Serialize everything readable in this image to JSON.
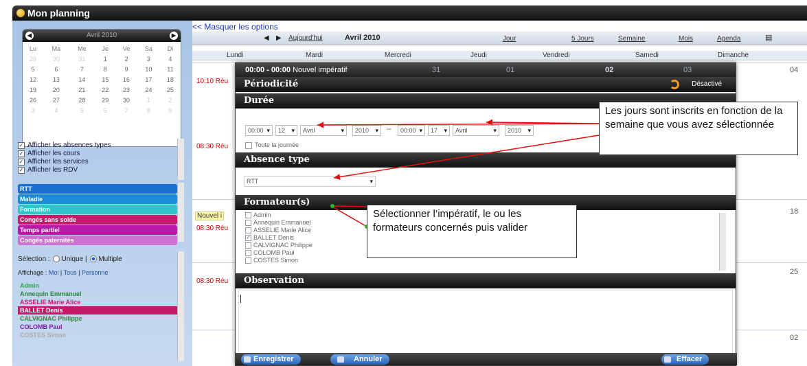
{
  "window": {
    "title": "Mon planning"
  },
  "minical": {
    "month_label": "Avril 2010",
    "weekdays": [
      "Lu",
      "Ma",
      "Me",
      "Je",
      "Ve",
      "Sa",
      "Di"
    ],
    "weeks": [
      [
        "29",
        "30",
        "31",
        "1",
        "2",
        "3",
        "4"
      ],
      [
        "5",
        "6",
        "7",
        "8",
        "9",
        "10",
        "11"
      ],
      [
        "12",
        "13",
        "14",
        "15",
        "16",
        "17",
        "18"
      ],
      [
        "19",
        "20",
        "21",
        "22",
        "23",
        "24",
        "25"
      ],
      [
        "26",
        "27",
        "28",
        "29",
        "30",
        "1",
        "2"
      ],
      [
        "3",
        "4",
        "5",
        "6",
        "7",
        "8",
        "9"
      ]
    ]
  },
  "filters": {
    "items": [
      "Afficher les absences types",
      "Afficher les cours",
      "Afficher les services",
      "Afficher les RDV"
    ]
  },
  "absences": [
    {
      "label": "RTT",
      "color": "#1a6fd0"
    },
    {
      "label": "Maladie",
      "color": "#1c8cd8"
    },
    {
      "label": "Formation",
      "color": "#2ec4c8"
    },
    {
      "label": "Congés sans solde",
      "color": "#c41a6a"
    },
    {
      "label": "Temps partiel",
      "color": "#b81aa8"
    },
    {
      "label": "Congés paternités",
      "color": "#d070d0"
    }
  ],
  "selection": {
    "label": "Sélection :",
    "unique": "Unique",
    "multiple": "Multiple"
  },
  "affichage": {
    "label": "Affichage :",
    "moi": "Moi",
    "tous": "Tous",
    "personne": "Personne"
  },
  "people": [
    {
      "name": "Admin",
      "color": "#2aa84a"
    },
    {
      "name": "Annequin Emmanuel",
      "color": "#2a8a3a"
    },
    {
      "name": "ASSELIE Marie Alice",
      "color": "#c41a6a"
    },
    {
      "name": "BALLET Denis",
      "color": "#ffffff"
    },
    {
      "name": "CALVIGNAC Philippe",
      "color": "#2a8a3a"
    },
    {
      "name": "COLOMB Paul",
      "color": "#7a1aa8"
    },
    {
      "name": "COSTES Simon",
      "color": "#aaaaaa"
    }
  ],
  "main": {
    "hide_options": "<< Masquer les options",
    "today": "Aujourd'hui",
    "month": "Avril 2010",
    "views": [
      "Jour",
      "5 Jours",
      "Semaine",
      "Mois",
      "Agenda"
    ],
    "days": [
      "Lundi",
      "Mardi",
      "Mercredi",
      "Jeudi",
      "Vendredi",
      "Samedi",
      "Dimanche"
    ],
    "events": [
      "10:10 Réu",
      "08:30 Réu",
      "Nouvel i",
      "08:30 Réu",
      "08:30 Réu"
    ],
    "dates": [
      "04",
      "18",
      "25",
      "02"
    ]
  },
  "modal": {
    "title_time": "00:00 - 00:00",
    "title_text": "Nouvel impératif",
    "header_dates": [
      "31",
      "01",
      "02",
      "03"
    ],
    "periodicite": "Périodicité",
    "desactive": "Désactivé",
    "duree": "Durée",
    "start": {
      "hour": "00:00",
      "day": "12",
      "month": "Avril",
      "year": "2010"
    },
    "end": {
      "hour": "00:00",
      "day": "17",
      "month": "Avril",
      "year": "2010"
    },
    "all_day": "Toute la journée",
    "absence_type_title": "Absence type",
    "absence_type_value": "RTT",
    "formateurs_title": "Formateur(s)",
    "formateurs": [
      {
        "name": "Admin",
        "checked": false
      },
      {
        "name": "Annequin Emmanuel",
        "checked": false
      },
      {
        "name": "ASSELIE Marie Alice",
        "checked": false
      },
      {
        "name": "BALLET Denis",
        "checked": true
      },
      {
        "name": "CALVIGNAC Philippe",
        "checked": false
      },
      {
        "name": "COLOMB Paul",
        "checked": false
      },
      {
        "name": "COSTES Simon",
        "checked": false
      }
    ],
    "observation_title": "Observation",
    "btn_save": "Enregistrer",
    "btn_cancel": "Annuler",
    "btn_clear": "Effacer"
  },
  "annotations": {
    "days_note": "Les jours sont inscrits en fonction de la semaine que vous avez sélectionnée",
    "select_note": "Sélectionner l’impératif, le ou les formateurs concernés puis valider"
  }
}
